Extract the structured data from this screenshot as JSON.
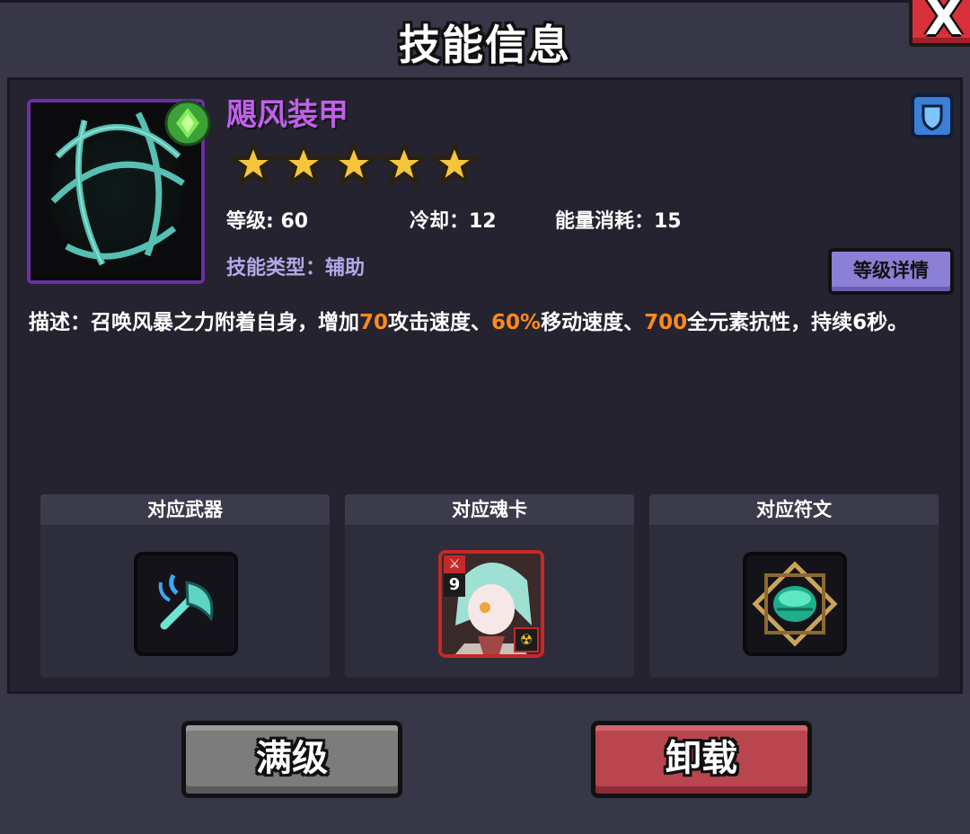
{
  "title": "技能信息",
  "close_label": "X",
  "skill": {
    "name": "飓风装甲",
    "stars": 5,
    "level": "等级: 60",
    "cooldown": "冷却：12",
    "energy": "能量消耗：15",
    "type": "技能类型：辅助"
  },
  "detail_button": "等级详情",
  "description": {
    "p1": "描述：召唤风暴之力附着自身，增加",
    "v1": "70",
    "p2": "攻击速度、",
    "v2": "60%",
    "p3": "移动速度、",
    "v3": "700",
    "p4": "全元素抗性，持续6秒。"
  },
  "slots": {
    "weapon": {
      "label": "对应武器",
      "icon": "axe-icon"
    },
    "soul_card": {
      "label": "对应魂卡",
      "card_number": "9",
      "icon": "character-card"
    },
    "rune": {
      "label": "对应符文",
      "icon": "emerald-rune-icon"
    }
  },
  "buttons": {
    "max_level": "满级",
    "unload": "卸载"
  },
  "colors": {
    "skill_name": "#c061e8",
    "highlight": "#ff8a1e",
    "detail_button": "#8c7fd6",
    "unload_button": "#b9454f",
    "max_button": "#7c7c7c"
  }
}
